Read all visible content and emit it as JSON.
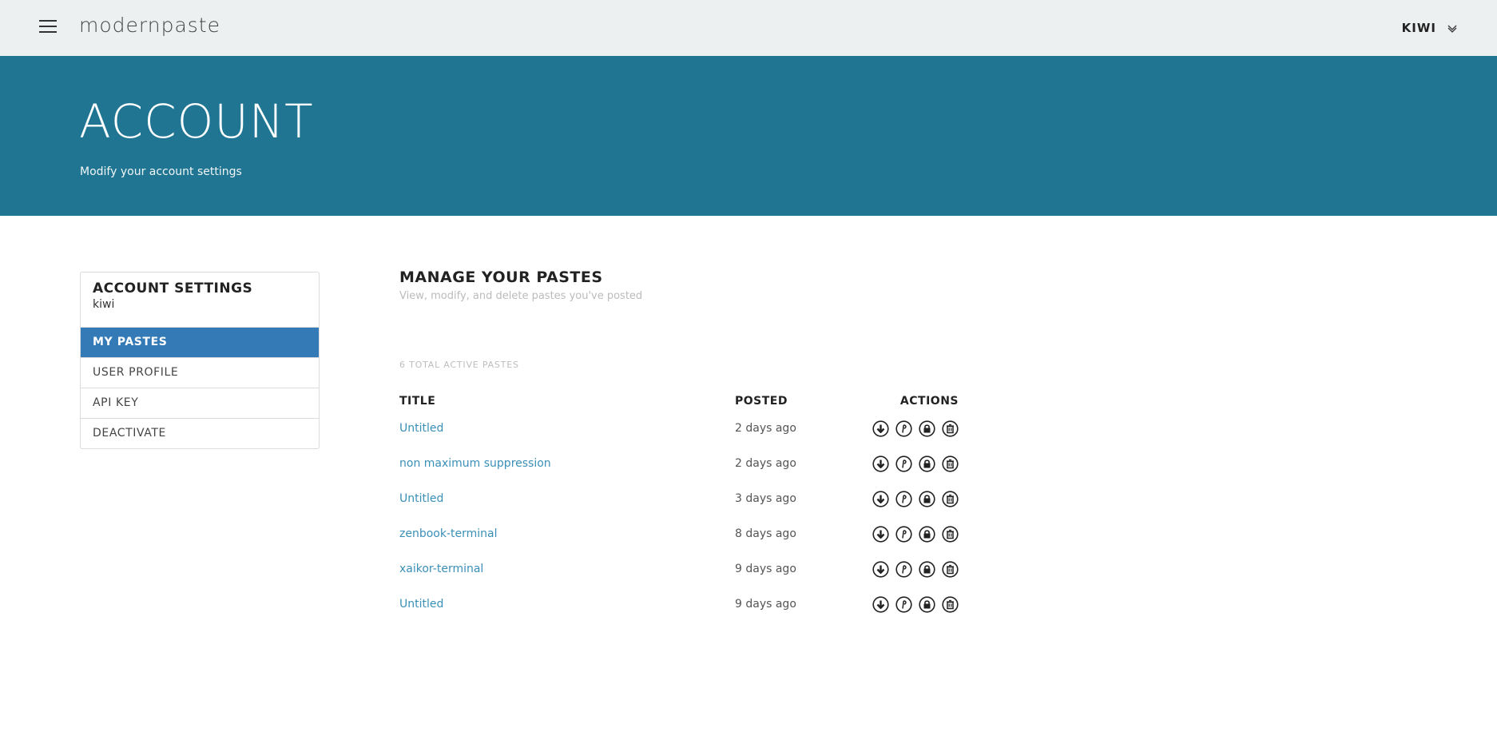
{
  "topbar": {
    "brand": "modernpaste",
    "user_label": "KIWI",
    "menu_icon": "hamburger-icon",
    "dropdown_icon": "chevron-down-icon"
  },
  "hero": {
    "title": "ACCOUNT",
    "subtitle": "Modify your account settings"
  },
  "sidebar": {
    "title": "ACCOUNT SETTINGS",
    "username": "kiwi",
    "items": [
      {
        "label": "MY PASTES",
        "active": true
      },
      {
        "label": "USER PROFILE",
        "active": false
      },
      {
        "label": "API KEY",
        "active": false
      },
      {
        "label": "DEACTIVATE",
        "active": false
      }
    ]
  },
  "main": {
    "heading": "MANAGE YOUR PASTES",
    "description": "View, modify, and delete pastes you've posted",
    "count_label": "6 TOTAL ACTIVE PASTES",
    "columns": {
      "title": "TITLE",
      "posted": "POSTED",
      "actions": "ACTIONS"
    },
    "action_icons": [
      "download-icon",
      "password-icon",
      "lock-icon",
      "delete-icon"
    ],
    "pastes": [
      {
        "title": "Untitled",
        "posted": "2 days ago"
      },
      {
        "title": "non maximum suppression",
        "posted": "2 days ago"
      },
      {
        "title": "Untitled",
        "posted": "3 days ago"
      },
      {
        "title": "zenbook-terminal",
        "posted": "8 days ago"
      },
      {
        "title": "xaikor-terminal",
        "posted": "9 days ago"
      },
      {
        "title": "Untitled",
        "posted": "9 days ago"
      }
    ]
  },
  "colors": {
    "hero_bg": "#1f7592",
    "topbar_bg": "#ecf0f1",
    "active_item": "#337ab7",
    "link": "#3a8fb7"
  }
}
